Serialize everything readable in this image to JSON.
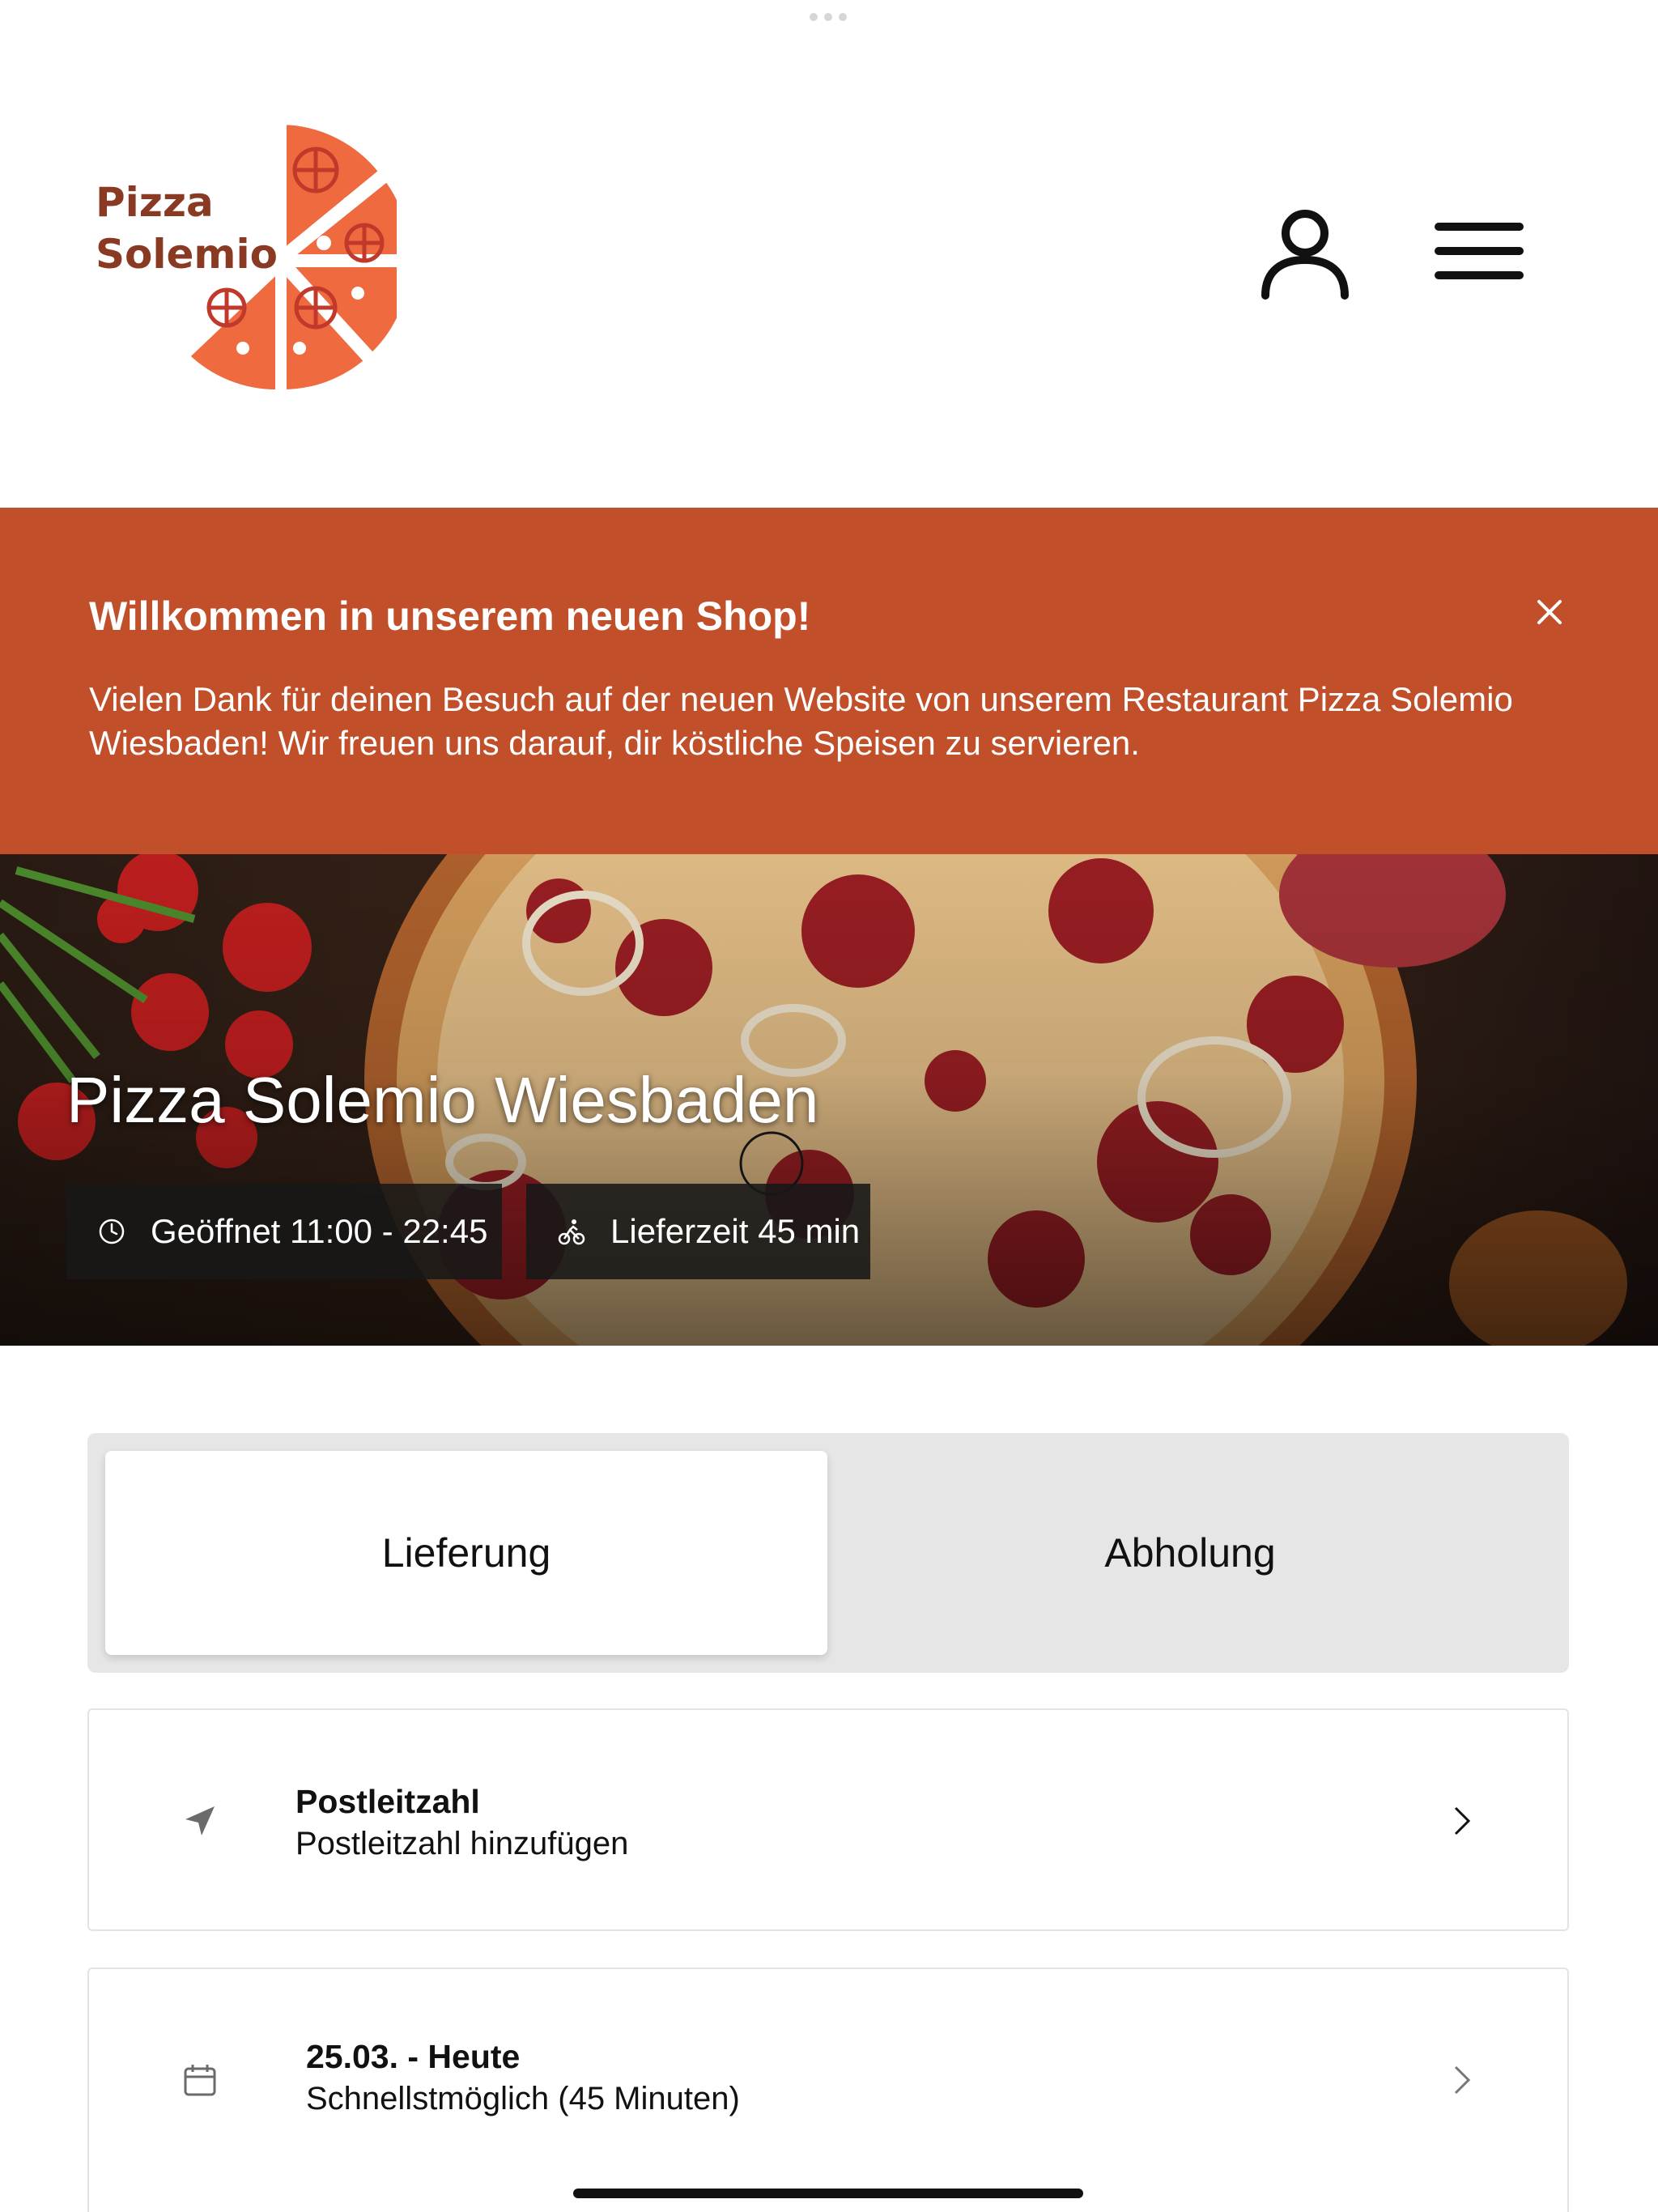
{
  "header": {
    "logo_line1": "Pizza",
    "logo_line2": "Solemio",
    "brand_color": "#c04f2a",
    "logo_text_color": "#8a3a22"
  },
  "banner": {
    "title": "Willkommen in unserem neuen Shop!",
    "text": "Vielen Dank für deinen Besuch auf der neuen Website von unserem Restaurant Pizza Solemio Wiesbaden! Wir freuen uns darauf, dir köstliche Speisen zu servieren.",
    "background": "#c04f2a"
  },
  "hero": {
    "title": "Pizza Solemio Wiesbaden",
    "opening": "Geöffnet 11:00 - 22:45",
    "delivery_time": "Lieferzeit 45 min"
  },
  "order_mode": {
    "options": [
      "Lieferung",
      "Abholung"
    ],
    "selected": "Lieferung"
  },
  "postcode": {
    "title": "Postleitzahl",
    "subtitle": "Postleitzahl hinzufügen",
    "icon": "location-arrow-icon"
  },
  "schedule": {
    "title": "25.03. - Heute",
    "subtitle": "Schnellstmöglich (45 Minuten)",
    "icon": "calendar-icon"
  }
}
